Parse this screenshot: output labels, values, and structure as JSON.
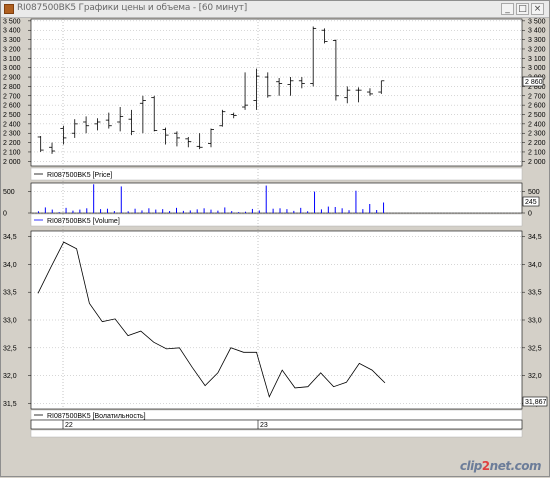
{
  "window": {
    "title": "RI087500BK5 Графики цены и объема - [60 минут]",
    "buttons": {
      "minimize": "_",
      "maximize": "□",
      "close": "×"
    }
  },
  "panes": {
    "price": {
      "legend": "RI087500BK5 [Price]",
      "last_value_label": "2 860"
    },
    "volume": {
      "legend": "RI087500BK5 [Volume]",
      "last_value_label": "245"
    },
    "volatility": {
      "legend": "RI087500BK5 [Волатильность]",
      "last_value_label": "31,867"
    }
  },
  "time_axis": {
    "day_labels": [
      "22",
      "23"
    ]
  },
  "watermark": {
    "text_left": "clip",
    "text_dot": "2",
    "text_right": "net.com"
  },
  "colors": {
    "volume_bar": "#0000ff",
    "price_bar": "#000000",
    "line": "#000000",
    "grid": "#999999",
    "pane_bg": "#ffffff"
  },
  "chart_data": [
    {
      "type": "ohlc",
      "name": "price",
      "ylim": [
        1950,
        3520
      ],
      "y_ticks": [
        2000,
        2100,
        2200,
        2300,
        2400,
        2500,
        2600,
        2700,
        2800,
        2900,
        3000,
        3100,
        3200,
        3300,
        3400,
        3500
      ],
      "y_tick_labels": [
        "2 000",
        "2 100",
        "2 200",
        "2 300",
        "2 400",
        "2 500",
        "2 600",
        "2 700",
        "2 800",
        "2 900",
        "3 000",
        "3 100",
        "3 200",
        "3 300",
        "3 400",
        "3 500"
      ],
      "bars": [
        {
          "o": 2260,
          "h": 2270,
          "l": 2100,
          "c": 2120
        },
        {
          "o": 2150,
          "h": 2200,
          "l": 2080,
          "c": 2110
        },
        {
          "o": 2350,
          "h": 2380,
          "l": 2180,
          "c": 2250
        },
        {
          "o": 2300,
          "h": 2450,
          "l": 2250,
          "c": 2400
        },
        {
          "o": 2420,
          "h": 2480,
          "l": 2300,
          "c": 2380
        },
        {
          "o": 2400,
          "h": 2460,
          "l": 2330,
          "c": 2420
        },
        {
          "o": 2440,
          "h": 2520,
          "l": 2350,
          "c": 2380
        },
        {
          "o": 2420,
          "h": 2580,
          "l": 2320,
          "c": 2480
        },
        {
          "o": 2450,
          "h": 2550,
          "l": 2280,
          "c": 2320
        },
        {
          "o": 2620,
          "h": 2700,
          "l": 2300,
          "c": 2650
        },
        {
          "o": 2680,
          "h": 2700,
          "l": 2320,
          "c": 2330
        },
        {
          "o": 2340,
          "h": 2360,
          "l": 2180,
          "c": 2280
        },
        {
          "o": 2300,
          "h": 2320,
          "l": 2160,
          "c": 2250
        },
        {
          "o": 2240,
          "h": 2260,
          "l": 2150,
          "c": 2210
        },
        {
          "o": 2160,
          "h": 2300,
          "l": 2130,
          "c": 2150
        },
        {
          "o": 2190,
          "h": 2350,
          "l": 2150,
          "c": 2340
        },
        {
          "o": 2380,
          "h": 2550,
          "l": 2370,
          "c": 2530
        },
        {
          "o": 2500,
          "h": 2520,
          "l": 2460,
          "c": 2490
        },
        {
          "o": 2580,
          "h": 2950,
          "l": 2550,
          "c": 2600
        },
        {
          "o": 2650,
          "h": 2990,
          "l": 2550,
          "c": 2910
        },
        {
          "o": 2900,
          "h": 2950,
          "l": 2680,
          "c": 2700
        },
        {
          "o": 2850,
          "h": 2890,
          "l": 2700,
          "c": 2830
        },
        {
          "o": 2820,
          "h": 2900,
          "l": 2700,
          "c": 2860
        },
        {
          "o": 2860,
          "h": 2900,
          "l": 2780,
          "c": 2830
        },
        {
          "o": 2830,
          "h": 3440,
          "l": 2800,
          "c": 3420
        },
        {
          "o": 3400,
          "h": 3420,
          "l": 3260,
          "c": 3280
        },
        {
          "o": 3290,
          "h": 3300,
          "l": 2650,
          "c": 2700
        },
        {
          "o": 2680,
          "h": 2800,
          "l": 2620,
          "c": 2760
        },
        {
          "o": 2760,
          "h": 2790,
          "l": 2630,
          "c": 2760
        },
        {
          "o": 2740,
          "h": 2780,
          "l": 2700,
          "c": 2720
        },
        {
          "o": 2740,
          "h": 2860,
          "l": 2720,
          "c": 2860
        }
      ]
    },
    {
      "type": "bar",
      "name": "volume",
      "ylim": [
        0,
        700
      ],
      "y_ticks": [
        0,
        500
      ],
      "y_tick_labels": [
        "0",
        "500"
      ],
      "values": [
        40,
        130,
        80,
        20,
        120,
        55,
        80,
        110,
        670,
        90,
        100,
        45,
        620,
        40,
        100,
        60,
        110,
        80,
        90,
        45,
        120,
        50,
        60,
        85,
        110,
        80,
        55,
        130,
        45,
        20,
        30,
        95,
        60,
        640,
        100,
        110,
        90,
        50,
        120,
        40,
        500,
        85,
        150,
        140,
        110,
        65,
        520,
        90,
        210,
        70,
        245
      ]
    },
    {
      "type": "line",
      "name": "volatility",
      "ylim": [
        31.4,
        34.6
      ],
      "y_ticks": [
        31.5,
        32.0,
        32.5,
        33.0,
        33.5,
        34.0,
        34.5
      ],
      "y_tick_labels": [
        "31,5",
        "32,0",
        "32,5",
        "33,0",
        "33,5",
        "34,0",
        "34,5"
      ],
      "values": [
        33.48,
        33.95,
        34.4,
        34.28,
        33.3,
        32.97,
        33.02,
        32.72,
        32.8,
        32.6,
        32.48,
        32.5,
        32.15,
        31.82,
        32.05,
        32.5,
        32.42,
        32.42,
        31.62,
        32.1,
        31.78,
        31.8,
        32.05,
        31.8,
        31.88,
        32.22,
        32.1,
        31.87
      ]
    }
  ]
}
